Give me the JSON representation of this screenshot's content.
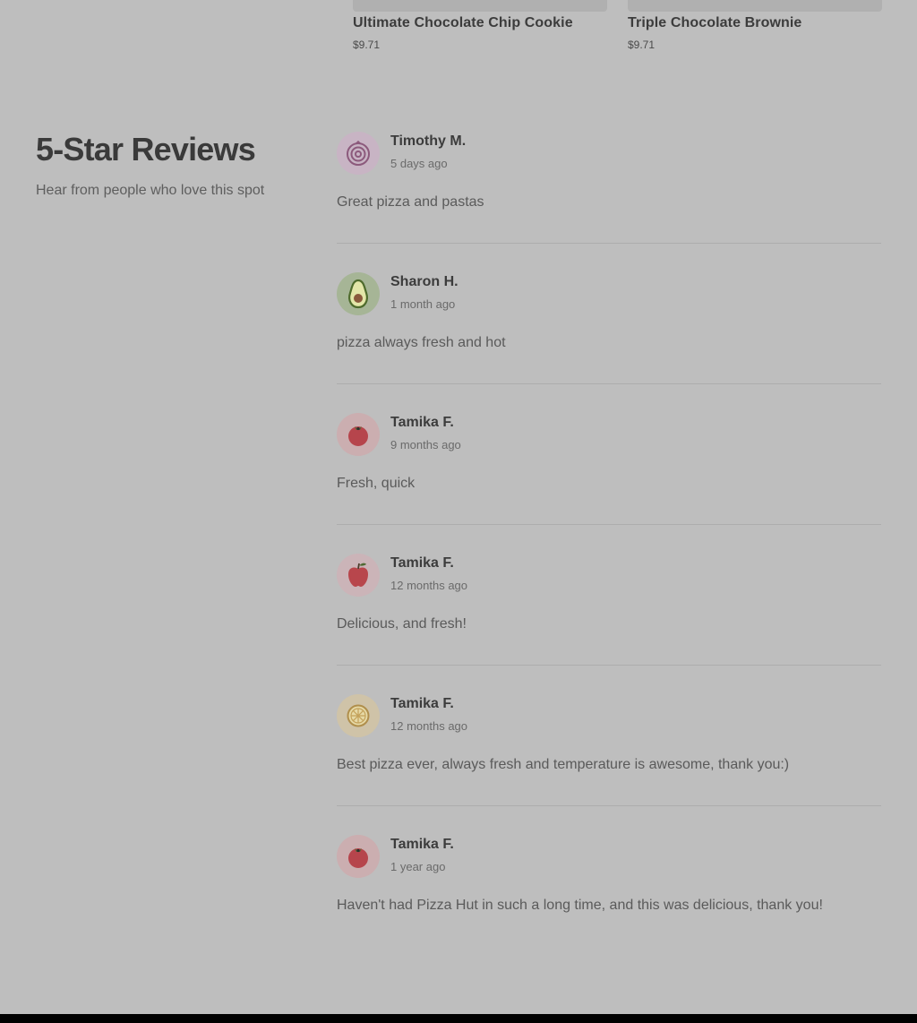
{
  "products": [
    {
      "name": "Ultimate Chocolate Chip Cookie",
      "price": "$9.71"
    },
    {
      "name": "Triple Chocolate Brownie",
      "price": "$9.71"
    }
  ],
  "reviews_section": {
    "title": "5-Star Reviews",
    "subtitle": "Hear from people who love this spot"
  },
  "reviews": [
    {
      "name": "Timothy M.",
      "date": "5 days ago",
      "text": "Great pizza and pastas",
      "avatar_icon": "onion-icon",
      "avatar_bg": "#c8b4c4"
    },
    {
      "name": "Sharon H.",
      "date": "1 month ago",
      "text": "pizza always fresh and hot",
      "avatar_icon": "avocado-icon",
      "avatar_bg": "#a6b596"
    },
    {
      "name": "Tamika F.",
      "date": "9 months ago",
      "text": "Fresh, quick",
      "avatar_icon": "tomato-icon",
      "avatar_bg": "#cbaeb0"
    },
    {
      "name": "Tamika F.",
      "date": "12 months ago",
      "text": "Delicious, and fresh!",
      "avatar_icon": "apple-icon",
      "avatar_bg": "#cbb4b8"
    },
    {
      "name": "Tamika F.",
      "date": "12 months ago",
      "text": "Best pizza ever, always fresh and temperature is awesome, thank you:)",
      "avatar_icon": "lemon-icon",
      "avatar_bg": "#cfc3a8"
    },
    {
      "name": "Tamika F.",
      "date": "1 year ago",
      "text": "Haven't had Pizza Hut in such a long time, and this was delicious, thank you!",
      "avatar_icon": "tomato-icon",
      "avatar_bg": "#cbaeb0"
    }
  ]
}
